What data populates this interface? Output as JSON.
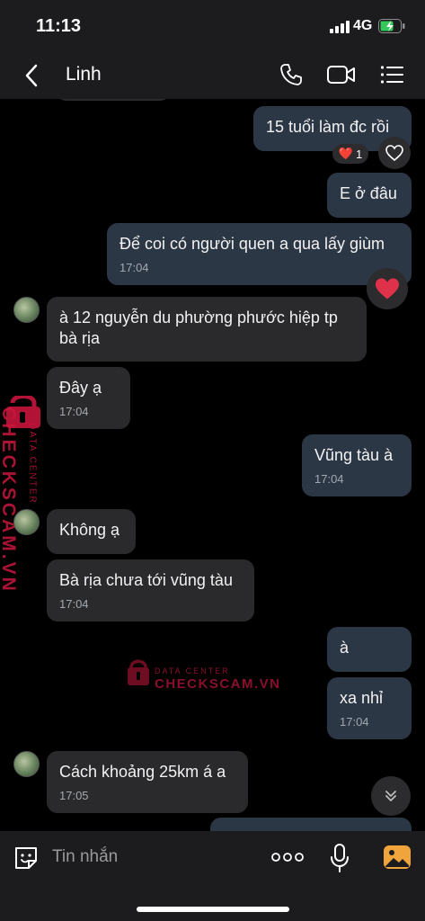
{
  "status_bar": {
    "time": "11:13",
    "network": "4G",
    "signal_icon": "signal-icon",
    "battery_icon": "battery-charging-icon"
  },
  "header": {
    "contact_name": "Linh",
    "back_icon": "chevron-left-icon",
    "call_icon": "phone-icon",
    "video_icon": "video-camera-icon",
    "menu_icon": "list-menu-icon"
  },
  "messages": [
    {
      "side": "out",
      "text": "15 tuổi làm đc rồi",
      "time": ""
    },
    {
      "side": "out",
      "text": "E ở đâu",
      "time": ""
    },
    {
      "side": "out",
      "text": "Để coi có người quen a qua lấy giùm",
      "time": "17:04"
    },
    {
      "side": "in",
      "text": "à 12 nguyễn du phường phước hiệp tp bà rịa",
      "time": ""
    },
    {
      "side": "in",
      "text": "Đây ạ",
      "time": "17:04"
    },
    {
      "side": "out",
      "text": "Vũng tàu à",
      "time": "17:04"
    },
    {
      "side": "in",
      "text": "Không ạ",
      "time": ""
    },
    {
      "side": "in",
      "text": "Bà rịa chưa tới vũng tàu",
      "time": "17:04"
    },
    {
      "side": "out",
      "text": "à",
      "time": ""
    },
    {
      "side": "out",
      "text": "xa nhỉ",
      "time": "17:04"
    },
    {
      "side": "in",
      "text": "Cách khoảng 25km á a",
      "time": "17:05"
    }
  ],
  "reaction": {
    "emoji": "❤️",
    "count": "1"
  },
  "watermark": {
    "top_text": "DATA CENTER",
    "brand": "CHECKSCAM.VN"
  },
  "composer": {
    "placeholder": "Tin nhắn",
    "sticker_icon": "sticker-icon",
    "more_icon": "more-dots-icon",
    "mic_icon": "microphone-icon",
    "gallery_icon": "gallery-icon"
  },
  "colors": {
    "outgoing_bubble": "#2c3746",
    "incoming_bubble": "#2a2a2c",
    "bar_background": "#1c1c1e",
    "reaction_heart": "#e0314b"
  }
}
